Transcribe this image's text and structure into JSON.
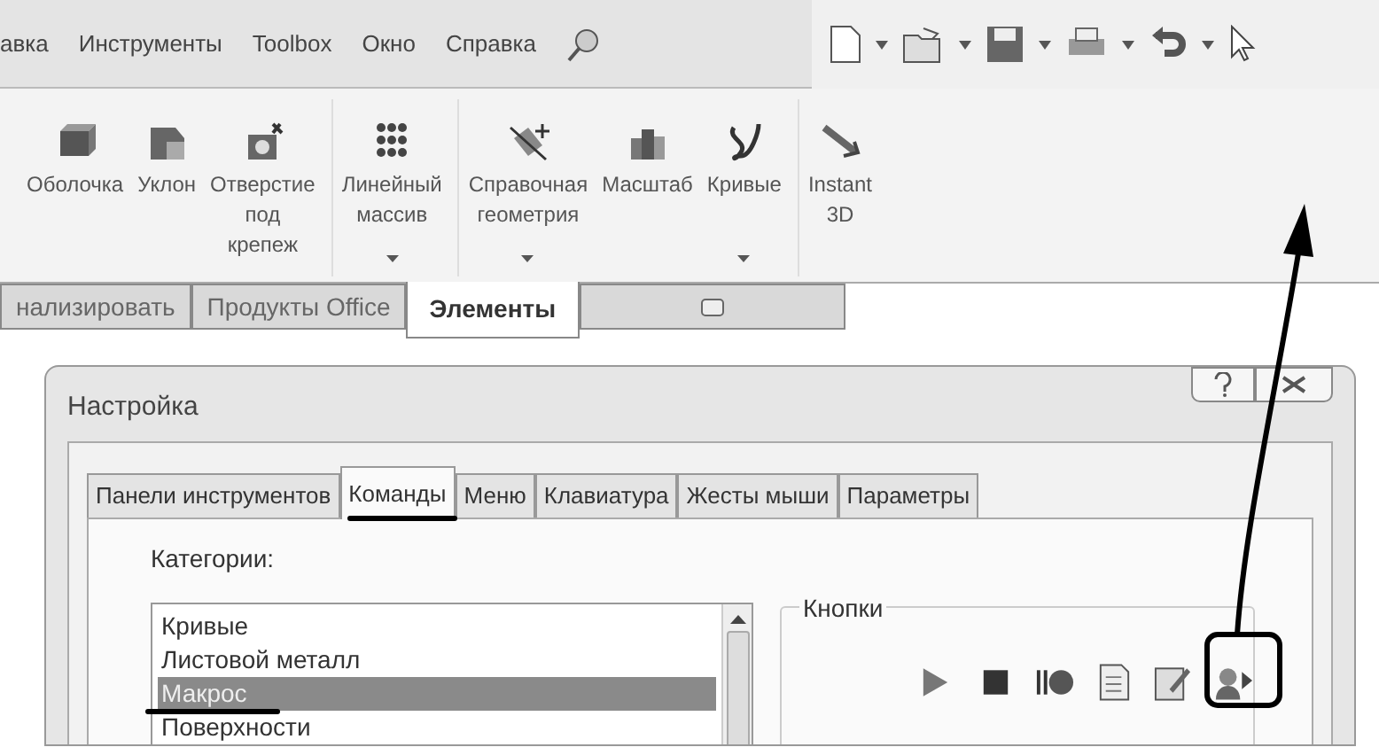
{
  "menu": {
    "items": [
      "авка",
      "Инструменты",
      "Toolbox",
      "Окно",
      "Справка"
    ]
  },
  "ribbon": {
    "groups": [
      {
        "buttons": [
          {
            "label": "Оболочка",
            "dropdown": false
          },
          {
            "label": "Уклон",
            "dropdown": false
          },
          {
            "label": "Отверстие\nпод\nкрепеж",
            "dropdown": false
          }
        ]
      },
      {
        "buttons": [
          {
            "label": "Линейный\nмассив",
            "dropdown": true
          }
        ]
      },
      {
        "buttons": [
          {
            "label": "Справочная\nгеометрия",
            "dropdown": true
          },
          {
            "label": "Масштаб",
            "dropdown": false
          },
          {
            "label": "Кривые",
            "dropdown": true
          }
        ]
      },
      {
        "buttons": [
          {
            "label": "Instant\n3D",
            "dropdown": false
          }
        ]
      }
    ]
  },
  "command_tabs": [
    {
      "kind": "text",
      "label": "нализировать",
      "selected": false
    },
    {
      "kind": "text",
      "label": "Продукты Office",
      "selected": false
    },
    {
      "kind": "text",
      "label": "Элементы",
      "selected": true
    },
    {
      "kind": "icon",
      "selected": false
    }
  ],
  "dialog": {
    "title": "Настройка",
    "tabs": [
      {
        "label": "Панели инструментов",
        "selected": false
      },
      {
        "label": "Команды",
        "selected": true
      },
      {
        "label": "Меню",
        "selected": false
      },
      {
        "label": "Клавиатура",
        "selected": false
      },
      {
        "label": "Жесты мыши",
        "selected": false
      },
      {
        "label": "Параметры",
        "selected": false
      }
    ],
    "categories_label": "Категории:",
    "categories": [
      {
        "label": "Кривые",
        "selected": false
      },
      {
        "label": "Листовой металл",
        "selected": false
      },
      {
        "label": "Макрос",
        "selected": true
      },
      {
        "label": "Поверхности",
        "selected": false
      }
    ],
    "buttons_group": {
      "title": "Кнопки",
      "buttons": [
        {
          "kind": "run"
        },
        {
          "kind": "stop"
        },
        {
          "kind": "record"
        },
        {
          "kind": "new"
        },
        {
          "kind": "edit"
        },
        {
          "kind": "custom"
        }
      ]
    }
  }
}
